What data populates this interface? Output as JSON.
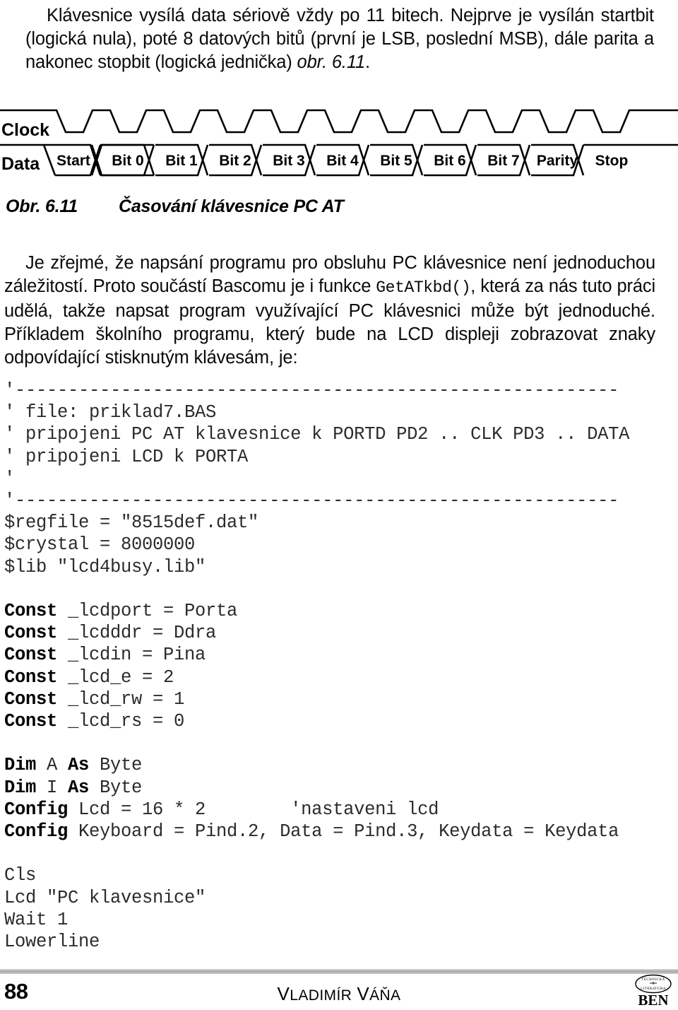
{
  "intro_paragraph": {
    "indent": true,
    "run1": "Klávesnice vysílá data sériově vždy po 11 bitech. Nejprve je vysílán startbit (logická nula), poté 8 datových bitů (první je LSB, poslední MSB), dále parita a nakonec stopbit (logická jednička) ",
    "run2_italic": "obr. 6.11",
    "run3": "."
  },
  "figure": {
    "name": "timing-diagram-pc-at-keyboard",
    "row_labels": [
      "Clock",
      "Data"
    ],
    "data_cells": [
      "Start",
      "Bit 0",
      "Bit 1",
      "Bit 2",
      "Bit 3",
      "Bit 4",
      "Bit 5",
      "Bit 6",
      "Bit 7",
      "Parity",
      "Stop"
    ],
    "clock_pulses": 11,
    "stroke_color": "#000000"
  },
  "caption": {
    "number": "Obr. 6.11",
    "text": "Časování klávesnice PC AT"
  },
  "body_paragraph": {
    "run1": "Je zřejmé, že napsání programu pro obsluhu PC klávesnice není jednoduchou záležitostí. Proto součástí Bascomu je i funkce ",
    "run2_mono": "GetATkbd()",
    "run3": ", která za nás tuto práci udělá, takže napsat program využívající PC klávesnici může být jednoduché. Příkladem školního programu, který bude na LCD displeji zobrazovat znaky odpovídající stisknutým klávesám, je:"
  },
  "code": {
    "lines": [
      [
        {
          "t": "'---------------------------------------------------------",
          "b": false
        }
      ],
      [
        {
          "t": "' file: priklad7.BAS",
          "b": false
        }
      ],
      [
        {
          "t": "' pripojeni PC AT klavesnice k PORTD PD2 .. CLK PD3 .. DATA",
          "b": false
        }
      ],
      [
        {
          "t": "' pripojeni LCD k PORTA",
          "b": false
        }
      ],
      [
        {
          "t": "'",
          "b": false
        }
      ],
      [
        {
          "t": "'---------------------------------------------------------",
          "b": false
        }
      ],
      [
        {
          "t": "$regfile = \"8515def.dat\"",
          "b": false
        }
      ],
      [
        {
          "t": "$crystal = 8000000",
          "b": false
        }
      ],
      [
        {
          "t": "$lib \"lcd4busy.lib\"",
          "b": false
        }
      ],
      [
        {
          "t": "",
          "b": false
        }
      ],
      [
        {
          "t": "Const",
          "b": true
        },
        {
          "t": " _lcdport = Porta",
          "b": false
        }
      ],
      [
        {
          "t": "Const",
          "b": true
        },
        {
          "t": " _lcdddr = Ddra",
          "b": false
        }
      ],
      [
        {
          "t": "Const",
          "b": true
        },
        {
          "t": " _lcdin = Pina",
          "b": false
        }
      ],
      [
        {
          "t": "Const",
          "b": true
        },
        {
          "t": " _lcd_e = 2",
          "b": false
        }
      ],
      [
        {
          "t": "Const",
          "b": true
        },
        {
          "t": " _lcd_rw = 1",
          "b": false
        }
      ],
      [
        {
          "t": "Const",
          "b": true
        },
        {
          "t": " _lcd_rs = 0",
          "b": false
        }
      ],
      [
        {
          "t": "",
          "b": false
        }
      ],
      [
        {
          "t": "Dim",
          "b": true
        },
        {
          "t": " A ",
          "b": false
        },
        {
          "t": "As",
          "b": true
        },
        {
          "t": " Byte",
          "b": false
        }
      ],
      [
        {
          "t": "Dim",
          "b": true
        },
        {
          "t": " I ",
          "b": false
        },
        {
          "t": "As",
          "b": true
        },
        {
          "t": " Byte",
          "b": false
        }
      ],
      [
        {
          "t": "Config",
          "b": true
        },
        {
          "t": " Lcd = 16 * 2        'nastaveni lcd",
          "b": false
        }
      ],
      [
        {
          "t": "Config",
          "b": true
        },
        {
          "t": " Keyboard = Pind.2, Data = Pind.3, Keydata = Keydata",
          "b": false
        }
      ],
      [
        {
          "t": "",
          "b": false
        }
      ],
      [
        {
          "t": "Cls",
          "b": false
        }
      ],
      [
        {
          "t": "Lcd \"PC klavesnice\"",
          "b": false
        }
      ],
      [
        {
          "t": "Wait 1",
          "b": false
        }
      ],
      [
        {
          "t": "Lowerline",
          "b": false
        }
      ]
    ]
  },
  "footer": {
    "page_number": "88",
    "author_first": "V",
    "author_first_rest": "LADIMÍR",
    "author_last": "V",
    "author_last_rest": "ÁŇA",
    "logo": {
      "top_text_left": "TECHNICKÁ",
      "top_text_right": "LITERATURA",
      "wordmark": "BEN"
    }
  }
}
